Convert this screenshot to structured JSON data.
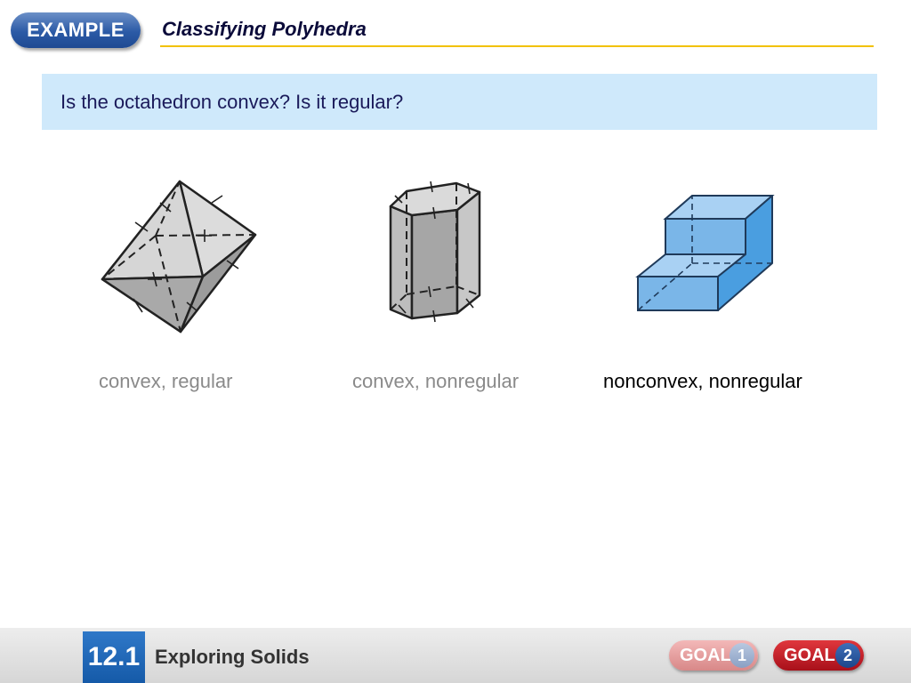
{
  "header": {
    "badge": "EXAMPLE",
    "title": "Classifying Polyhedra"
  },
  "question": "Is the octahedron convex? Is it regular?",
  "figures": [
    {
      "name": "octahedron",
      "caption": "convex, regular",
      "caption_style": "faded"
    },
    {
      "name": "hexagonal-prism",
      "caption": "convex, nonregular",
      "caption_style": "faded"
    },
    {
      "name": "nonconvex-solid",
      "caption": "nonconvex, nonregular",
      "caption_style": "strong"
    }
  ],
  "colors": {
    "badge": "#2b5aa6",
    "title_rule": "#f2c200",
    "question_bg": "#cfe9fb",
    "gray_solid": "#c4c4c4",
    "blue_solid": "#7ab6e8",
    "goal2": "#c01a22"
  },
  "footer": {
    "section": "12.1",
    "title": "Exploring Solids",
    "goal1_label": "GOAL",
    "goal1_num": "1",
    "goal2_label": "GOAL",
    "goal2_num": "2"
  }
}
